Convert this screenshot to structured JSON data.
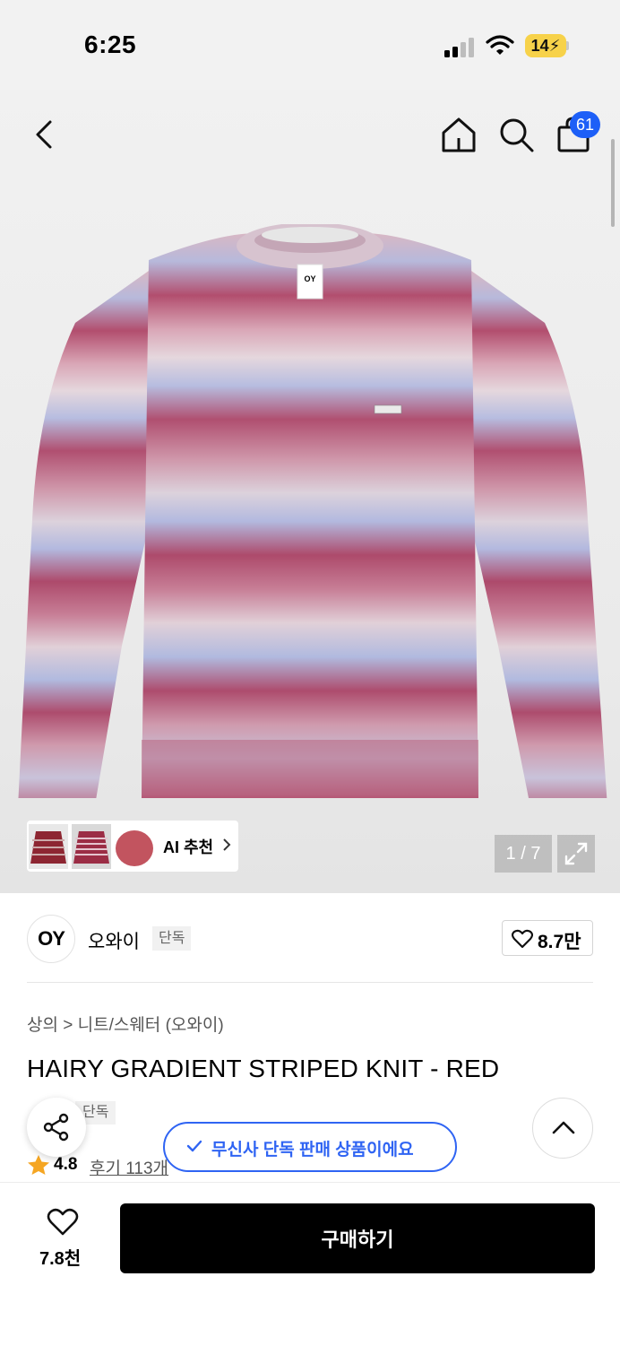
{
  "status_bar": {
    "time": "6:25",
    "battery": "14"
  },
  "header": {
    "cart_count": "61"
  },
  "gallery": {
    "counter": "1 / 7",
    "ai_recommend_label": "AI 추천"
  },
  "brand": {
    "logo_text": "OY",
    "name": "오와이",
    "tag": "단독",
    "like_count": "8.7만"
  },
  "product": {
    "breadcrumb": "상의 > 니트/스웨터 (오와이)",
    "title": "HAIRY GRADIENT STRIPED KNIT - RED",
    "exclusive_tag": "단독",
    "rating": "4.8",
    "reviews": "후기 113개"
  },
  "toast": {
    "text": "무신사 단독 판매 상품이에요"
  },
  "bottom": {
    "wish_count": "7.8천",
    "buy_label": "구매하기"
  },
  "colors": {
    "accent_blue": "#2f64f3",
    "badge_blue": "#1d5ff7",
    "battery_yellow": "#f7d24a",
    "star": "#f5a623",
    "buy_bg": "#000000"
  },
  "icons": [
    "chevron-left-icon",
    "home-icon",
    "search-icon",
    "bag-icon",
    "chevron-right-icon",
    "expand-icon",
    "heart-icon",
    "share-icon",
    "chevron-up-icon",
    "check-icon",
    "star-icon",
    "signal-icon",
    "wifi-icon"
  ]
}
